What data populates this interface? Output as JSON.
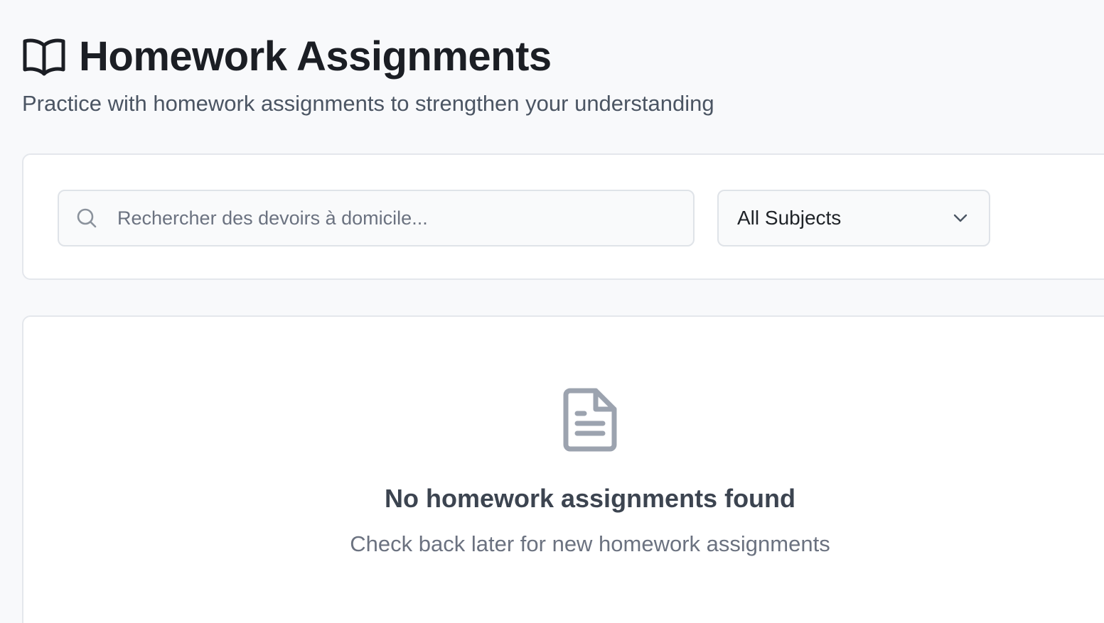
{
  "header": {
    "icon": "book-open-icon",
    "title": "Homework Assignments",
    "subtitle": "Practice with homework assignments to strengthen your understanding"
  },
  "filters": {
    "search": {
      "icon": "search-icon",
      "placeholder": "Rechercher des devoirs à domicile...",
      "value": ""
    },
    "subject": {
      "selected": "All Subjects",
      "icon": "chevron-down-icon"
    }
  },
  "empty_state": {
    "icon": "document-icon",
    "title": "No homework assignments found",
    "message": "Check back later for new homework assignments"
  },
  "colors": {
    "background": "#f8f9fb",
    "card": "#ffffff",
    "border": "#e4e7ec",
    "icon_muted": "#9ca3af"
  }
}
